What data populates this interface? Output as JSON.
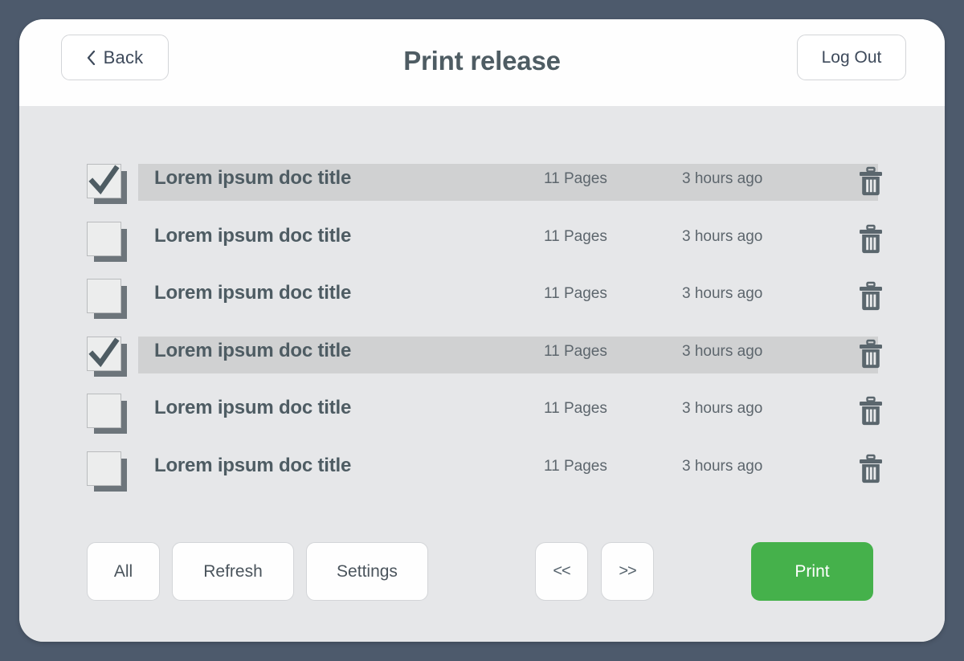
{
  "header": {
    "back_label": "Back",
    "back_icon": "chevron-left-icon",
    "title": "Print release",
    "logout_label": "Log Out"
  },
  "colors": {
    "frame": "#4d5a6c",
    "screen_bg": "#e6e7e9",
    "header_bg": "#fefefe",
    "row_highlight": "#d0d1d2",
    "text_primary": "#4e5c63",
    "text_secondary": "#5d666d",
    "print_green": "#45b14b",
    "button_border": "#d3d5d8"
  },
  "jobs": [
    {
      "title": "Lorem ipsum doc title",
      "pages": "11 Pages",
      "time": "3 hours ago",
      "selected": true,
      "delete_icon": "trash-icon"
    },
    {
      "title": "Lorem ipsum doc title",
      "pages": "11 Pages",
      "time": "3 hours ago",
      "selected": false,
      "delete_icon": "trash-icon"
    },
    {
      "title": "Lorem ipsum doc title",
      "pages": "11 Pages",
      "time": "3 hours ago",
      "selected": false,
      "delete_icon": "trash-icon"
    },
    {
      "title": "Lorem ipsum doc title",
      "pages": "11 Pages",
      "time": "3 hours ago",
      "selected": true,
      "delete_icon": "trash-icon"
    },
    {
      "title": "Lorem ipsum doc title",
      "pages": "11 Pages",
      "time": "3 hours ago",
      "selected": false,
      "delete_icon": "trash-icon"
    },
    {
      "title": "Lorem ipsum doc title",
      "pages": "11 Pages",
      "time": "3 hours ago",
      "selected": false,
      "delete_icon": "trash-icon"
    }
  ],
  "toolbar": {
    "all_label": "All",
    "refresh_label": "Refresh",
    "settings_label": "Settings",
    "prev_label": "<<",
    "next_label": ">>",
    "print_label": "Print"
  }
}
